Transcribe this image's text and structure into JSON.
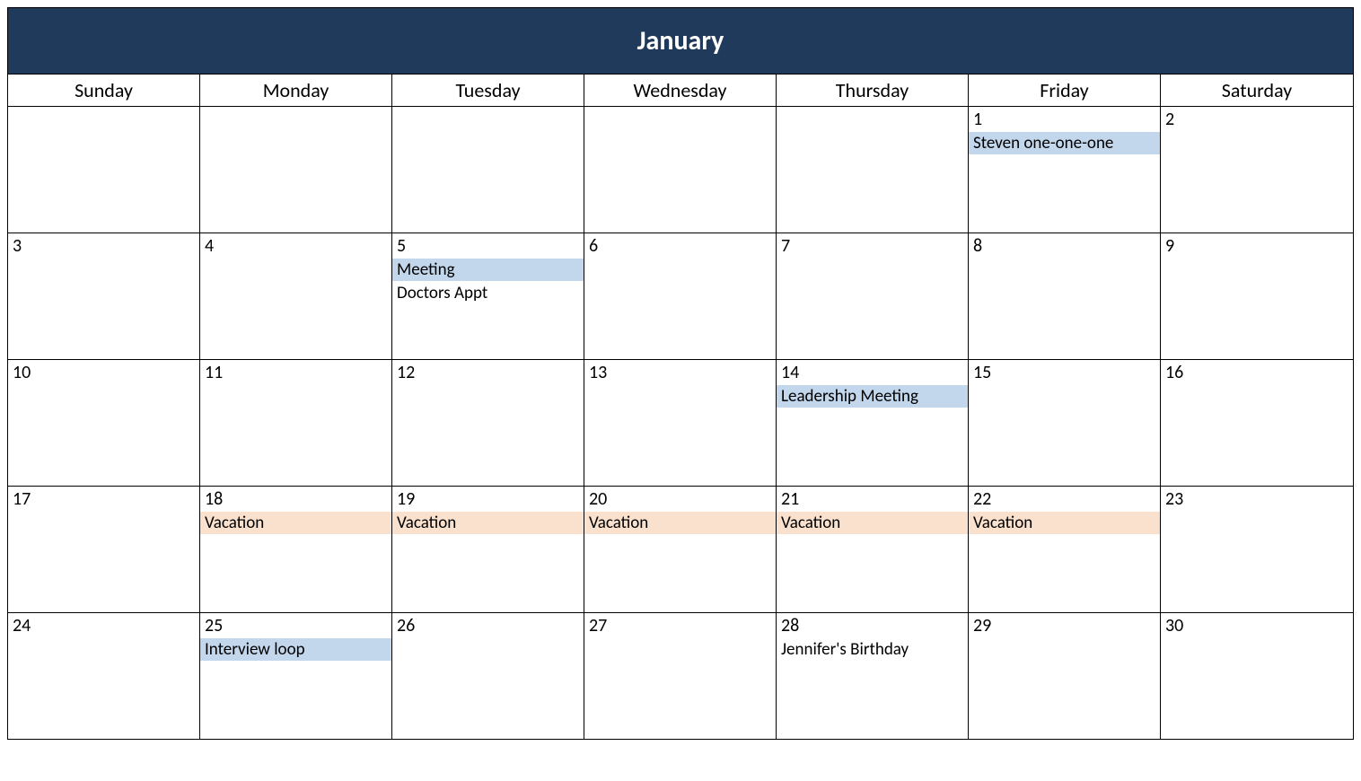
{
  "month": "January",
  "dayNames": [
    "Sunday",
    "Monday",
    "Tuesday",
    "Wednesday",
    "Thursday",
    "Friday",
    "Saturday"
  ],
  "colors": {
    "headerBg": "#1f3a5a",
    "highlightBlue": "#c3d7ec",
    "highlightOrange": "#fae1cd"
  },
  "weeks": [
    [
      {
        "day": "",
        "events": []
      },
      {
        "day": "",
        "events": []
      },
      {
        "day": "",
        "events": []
      },
      {
        "day": "",
        "events": []
      },
      {
        "day": "",
        "events": []
      },
      {
        "day": "1",
        "events": [
          {
            "text": "Steven one-one-one",
            "style": "highlight-blue"
          }
        ]
      },
      {
        "day": "2",
        "events": []
      }
    ],
    [
      {
        "day": "3",
        "events": []
      },
      {
        "day": "4",
        "events": []
      },
      {
        "day": "5",
        "events": [
          {
            "text": "Meeting",
            "style": "highlight-blue"
          },
          {
            "text": "Doctors Appt",
            "style": "plain"
          }
        ]
      },
      {
        "day": "6",
        "events": []
      },
      {
        "day": "7",
        "events": []
      },
      {
        "day": "8",
        "events": []
      },
      {
        "day": "9",
        "events": []
      }
    ],
    [
      {
        "day": "10",
        "events": []
      },
      {
        "day": "11",
        "events": []
      },
      {
        "day": "12",
        "events": []
      },
      {
        "day": "13",
        "events": []
      },
      {
        "day": "14",
        "events": [
          {
            "text": "Leadership Meeting",
            "style": "highlight-blue"
          }
        ]
      },
      {
        "day": "15",
        "events": []
      },
      {
        "day": "16",
        "events": []
      }
    ],
    [
      {
        "day": "17",
        "events": []
      },
      {
        "day": "18",
        "events": [
          {
            "text": "Vacation",
            "style": "highlight-orange"
          }
        ]
      },
      {
        "day": "19",
        "events": [
          {
            "text": "Vacation",
            "style": "highlight-orange"
          }
        ]
      },
      {
        "day": "20",
        "events": [
          {
            "text": "Vacation",
            "style": "highlight-orange"
          }
        ]
      },
      {
        "day": "21",
        "events": [
          {
            "text": "Vacation",
            "style": "highlight-orange"
          }
        ]
      },
      {
        "day": "22",
        "events": [
          {
            "text": "Vacation",
            "style": "highlight-orange"
          }
        ]
      },
      {
        "day": "23",
        "events": []
      }
    ],
    [
      {
        "day": "24",
        "events": []
      },
      {
        "day": "25",
        "events": [
          {
            "text": "Interview loop",
            "style": "highlight-blue"
          }
        ]
      },
      {
        "day": "26",
        "events": []
      },
      {
        "day": "27",
        "events": []
      },
      {
        "day": "28",
        "events": [
          {
            "text": "Jennifer's Birthday",
            "style": "plain"
          }
        ]
      },
      {
        "day": "29",
        "events": []
      },
      {
        "day": "30",
        "events": []
      }
    ]
  ]
}
